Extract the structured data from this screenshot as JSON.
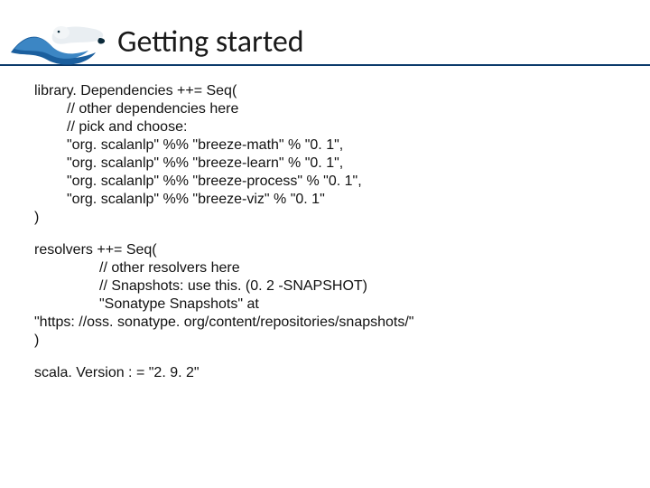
{
  "header": {
    "title": "Getting started"
  },
  "deps": {
    "open": "library. Dependencies ++= Seq(",
    "c1": "// other dependencies here",
    "c2": "// pick and choose:",
    "d1": "\"org. scalanlp\" %% \"breeze-math\" % \"0. 1\",",
    "d2": "\"org. scalanlp\" %% \"breeze-learn\" % \"0. 1\",",
    "d3": "\"org. scalanlp\" %% \"breeze-process\" % \"0. 1\",",
    "d4": "\"org. scalanlp\" %% \"breeze-viz\" % \"0. 1\"",
    "close": ")"
  },
  "resolvers": {
    "open": "resolvers ++= Seq(",
    "c1": "// other resolvers here",
    "c2": "// Snapshots: use this. (0. 2 -SNAPSHOT)",
    "r1": "\"Sonatype Snapshots\" at",
    "url": "\"https: //oss. sonatype. org/content/repositories/snapshots/\"",
    "close": ")"
  },
  "scala": {
    "line": "scala. Version : = \"2. 9. 2\""
  }
}
